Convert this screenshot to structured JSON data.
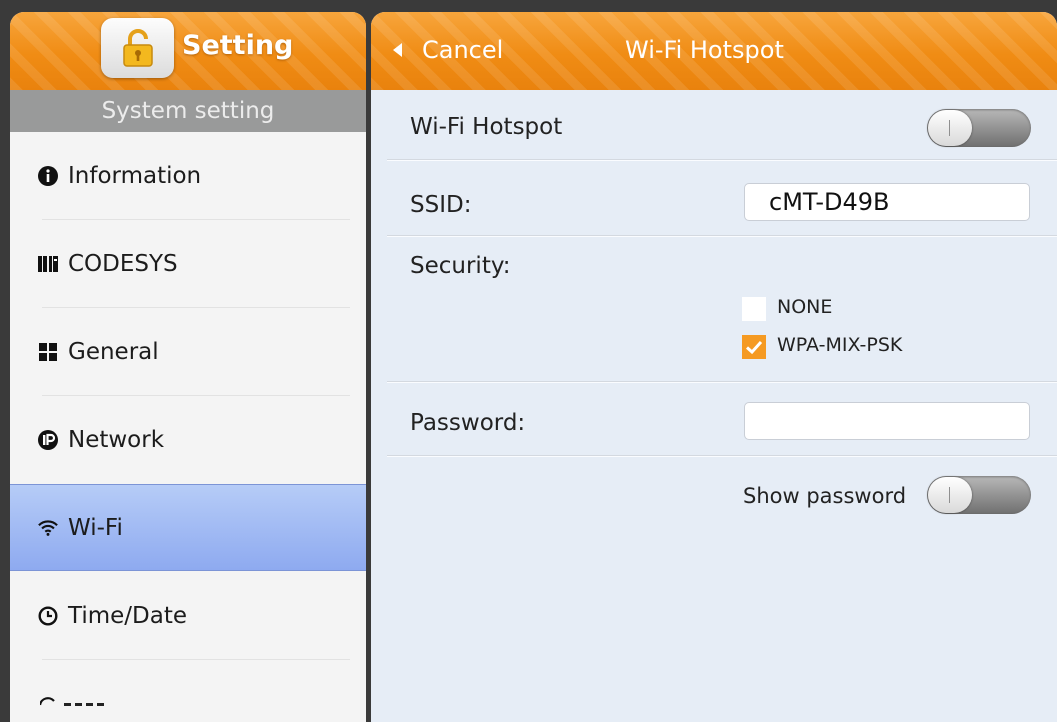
{
  "sidebar": {
    "title": "Setting",
    "section": "System setting",
    "items": [
      {
        "label": "Information",
        "icon": "info-circle-icon"
      },
      {
        "label": "CODESYS",
        "icon": "codesys-icon"
      },
      {
        "label": "General",
        "icon": "grid-icon"
      },
      {
        "label": "Network",
        "icon": "ip-icon"
      },
      {
        "label": "Wi-Fi",
        "icon": "wifi-icon",
        "active": true
      },
      {
        "label": "Time/Date",
        "icon": "clock-icon"
      }
    ]
  },
  "header": {
    "cancel_label": "Cancel",
    "title": "Wi-Fi Hotspot"
  },
  "form": {
    "hotspot_label": "Wi-Fi Hotspot",
    "hotspot_on": false,
    "ssid_label": "SSID:",
    "ssid_value": "cMT-D49B",
    "security_label": "Security:",
    "security_options": [
      {
        "label": "NONE",
        "checked": false
      },
      {
        "label": "WPA-MIX-PSK",
        "checked": true
      }
    ],
    "password_label": "Password:",
    "password_value": "",
    "show_password_label": "Show password",
    "show_password_on": false
  },
  "colors": {
    "accent_orange": "#f08c14",
    "selected_blue": "#9db8f3",
    "check_orange": "#f59a22"
  }
}
